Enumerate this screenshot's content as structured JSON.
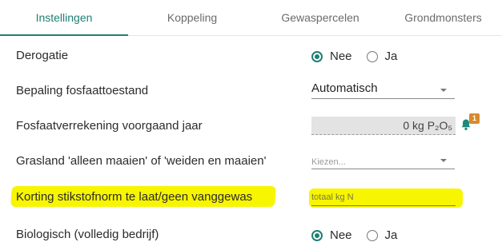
{
  "tabs": [
    {
      "label": "Instellingen",
      "active": true
    },
    {
      "label": "Koppeling",
      "active": false
    },
    {
      "label": "Gewaspercelen",
      "active": false
    },
    {
      "label": "Grondmonsters",
      "active": false
    }
  ],
  "form": {
    "derogatie": {
      "label": "Derogatie",
      "options": [
        "Nee",
        "Ja"
      ],
      "selected": "Nee"
    },
    "fosfaattoestand": {
      "label": "Bepaling fosfaattoestand",
      "value": "Automatisch"
    },
    "fosfaatverrekening": {
      "label": "Fosfaatverrekening voorgaand jaar",
      "value": "0 kg P₂O₅",
      "notification_count": "1",
      "icon": "bell-icon"
    },
    "grasland": {
      "label": "Grasland 'alleen maaien' of 'weiden en maaien'",
      "placeholder": "Kiezen..."
    },
    "korting": {
      "label": "Korting stikstofnorm te laat/geen vanggewas",
      "placeholder": "totaal kg N",
      "highlighted": true
    },
    "biologisch": {
      "label": "Biologisch (volledig bedrijf)",
      "options": [
        "Nee",
        "Ja"
      ],
      "selected": "Nee"
    }
  },
  "colors": {
    "accent": "#1e7f73",
    "highlight": "#f7f500",
    "badge": "#d9892b",
    "bell": "#1e8a7b"
  }
}
